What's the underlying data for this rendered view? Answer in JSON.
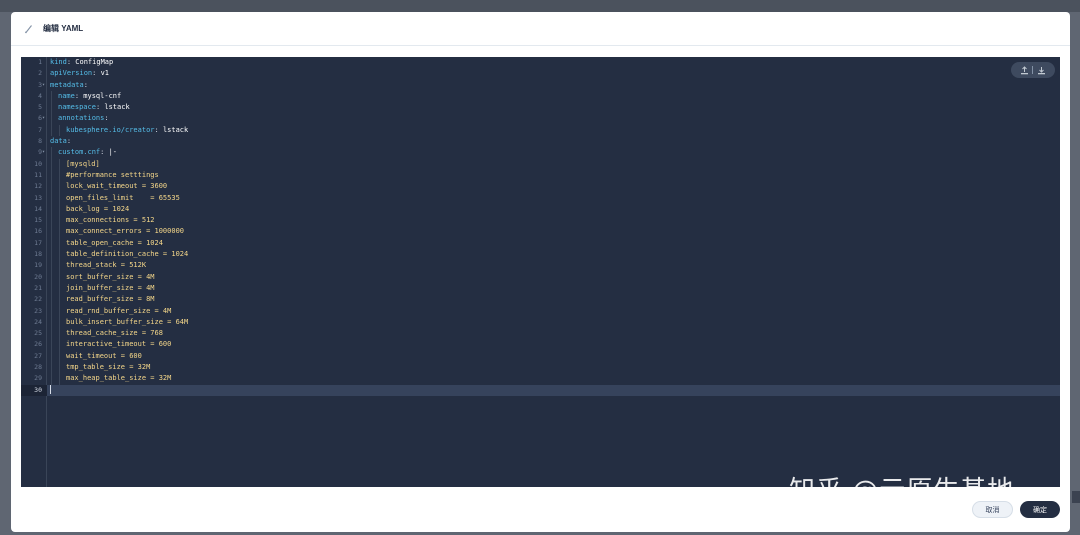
{
  "header": {
    "title": "编辑 YAML",
    "icon": "edit-icon"
  },
  "editor": {
    "toolbar": {
      "upload_icon": "upload-icon",
      "download_icon": "download-icon"
    },
    "active_line": 30,
    "lines": [
      {
        "n": "1",
        "indent": 0,
        "key": "kind",
        "val": "ConfigMap"
      },
      {
        "n": "2",
        "indent": 0,
        "key": "apiVersion",
        "val": "v1"
      },
      {
        "n": "3",
        "indent": 0,
        "key": "metadata",
        "val": "",
        "fold": true
      },
      {
        "n": "4",
        "indent": 1,
        "key": "name",
        "val": "mysql-cnf"
      },
      {
        "n": "5",
        "indent": 1,
        "key": "namespace",
        "val": "lstack"
      },
      {
        "n": "6",
        "indent": 1,
        "key": "annotations",
        "val": "",
        "fold": true
      },
      {
        "n": "7",
        "indent": 2,
        "key": "kubesphere.io/creator",
        "val": "lstack"
      },
      {
        "n": "8",
        "indent": 0,
        "key": "data",
        "val": ""
      },
      {
        "n": "9",
        "indent": 1,
        "key": "custom.cnf",
        "val": "|-",
        "fold": true
      },
      {
        "n": "10",
        "indent": 2,
        "text": "[mysqld]"
      },
      {
        "n": "11",
        "indent": 2,
        "text": "#performance setttings"
      },
      {
        "n": "12",
        "indent": 2,
        "text": "lock_wait_timeout = 3600"
      },
      {
        "n": "13",
        "indent": 2,
        "text": "open_files_limit    = 65535"
      },
      {
        "n": "14",
        "indent": 2,
        "text": "back_log = 1024"
      },
      {
        "n": "15",
        "indent": 2,
        "text": "max_connections = 512"
      },
      {
        "n": "16",
        "indent": 2,
        "text": "max_connect_errors = 1000000"
      },
      {
        "n": "17",
        "indent": 2,
        "text": "table_open_cache = 1024"
      },
      {
        "n": "18",
        "indent": 2,
        "text": "table_definition_cache = 1024"
      },
      {
        "n": "19",
        "indent": 2,
        "text": "thread_stack = 512K"
      },
      {
        "n": "20",
        "indent": 2,
        "text": "sort_buffer_size = 4M"
      },
      {
        "n": "21",
        "indent": 2,
        "text": "join_buffer_size = 4M"
      },
      {
        "n": "22",
        "indent": 2,
        "text": "read_buffer_size = 8M"
      },
      {
        "n": "23",
        "indent": 2,
        "text": "read_rnd_buffer_size = 4M"
      },
      {
        "n": "24",
        "indent": 2,
        "text": "bulk_insert_buffer_size = 64M"
      },
      {
        "n": "25",
        "indent": 2,
        "text": "thread_cache_size = 768"
      },
      {
        "n": "26",
        "indent": 2,
        "text": "interactive_timeout = 600"
      },
      {
        "n": "27",
        "indent": 2,
        "text": "wait_timeout = 600"
      },
      {
        "n": "28",
        "indent": 2,
        "text": "tmp_table_size = 32M"
      },
      {
        "n": "29",
        "indent": 2,
        "text": "max_heap_table_size = 32M"
      },
      {
        "n": "30",
        "indent": 0,
        "text": ""
      }
    ]
  },
  "footer": {
    "cancel_label": "取消",
    "ok_label": "确定"
  },
  "watermark": "知乎 @云原生基地",
  "colors": {
    "editor_bg": "#242e42",
    "key": "#55bde8",
    "string": "#f5d78a",
    "primary_button": "#242e42"
  }
}
